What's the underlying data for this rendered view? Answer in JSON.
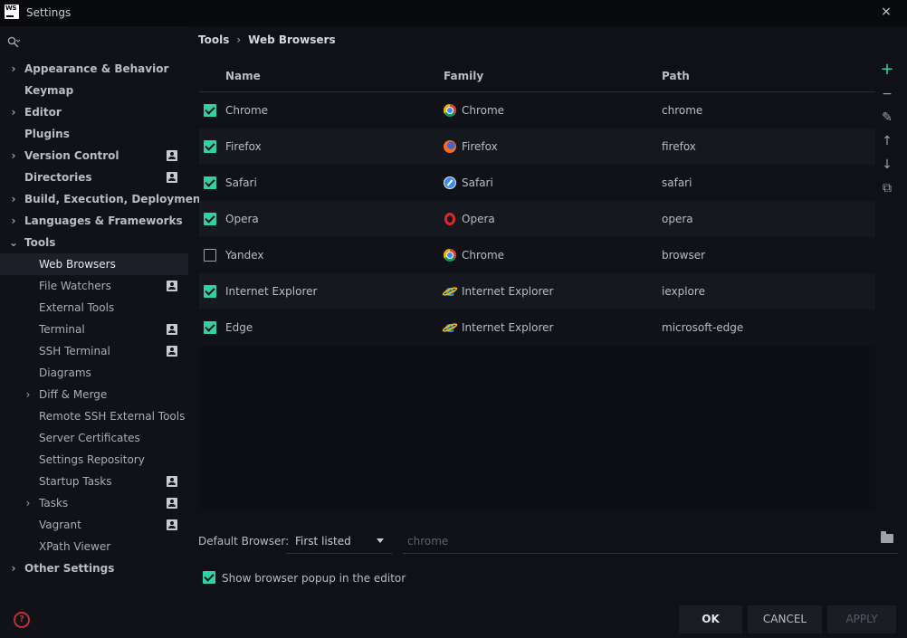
{
  "window": {
    "title": "Settings",
    "logo_text": "WS",
    "close_icon": "×"
  },
  "sidebar": {
    "search_placeholder": "",
    "items": [
      {
        "label": "Appearance & Behavior",
        "bold": true,
        "chevron": "›",
        "level": 0,
        "project": false
      },
      {
        "label": "Keymap",
        "bold": true,
        "chevron": "",
        "level": 0,
        "project": false
      },
      {
        "label": "Editor",
        "bold": true,
        "chevron": "›",
        "level": 0,
        "project": false
      },
      {
        "label": "Plugins",
        "bold": true,
        "chevron": "",
        "level": 0,
        "project": false
      },
      {
        "label": "Version Control",
        "bold": true,
        "chevron": "›",
        "level": 0,
        "project": true
      },
      {
        "label": "Directories",
        "bold": true,
        "chevron": "",
        "level": 0,
        "project": true
      },
      {
        "label": "Build, Execution, Deployment",
        "bold": true,
        "chevron": "›",
        "level": 0,
        "project": false
      },
      {
        "label": "Languages & Frameworks",
        "bold": true,
        "chevron": "›",
        "level": 0,
        "project": false
      },
      {
        "label": "Tools",
        "bold": true,
        "chevron": "⌄",
        "level": 0,
        "project": false
      },
      {
        "label": "Web Browsers",
        "bold": false,
        "chevron": "",
        "level": 1,
        "project": false,
        "selected": true
      },
      {
        "label": "File Watchers",
        "bold": false,
        "chevron": "",
        "level": 1,
        "project": true
      },
      {
        "label": "External Tools",
        "bold": false,
        "chevron": "",
        "level": 1,
        "project": false
      },
      {
        "label": "Terminal",
        "bold": false,
        "chevron": "",
        "level": 1,
        "project": true
      },
      {
        "label": "SSH Terminal",
        "bold": false,
        "chevron": "",
        "level": 1,
        "project": true
      },
      {
        "label": "Diagrams",
        "bold": false,
        "chevron": "",
        "level": 1,
        "project": false
      },
      {
        "label": "Diff & Merge",
        "bold": false,
        "chevron": "›",
        "level": 1,
        "project": false
      },
      {
        "label": "Remote SSH External Tools",
        "bold": false,
        "chevron": "",
        "level": 1,
        "project": false
      },
      {
        "label": "Server Certificates",
        "bold": false,
        "chevron": "",
        "level": 1,
        "project": false
      },
      {
        "label": "Settings Repository",
        "bold": false,
        "chevron": "",
        "level": 1,
        "project": false
      },
      {
        "label": "Startup Tasks",
        "bold": false,
        "chevron": "",
        "level": 1,
        "project": true
      },
      {
        "label": "Tasks",
        "bold": false,
        "chevron": "›",
        "level": 1,
        "project": true
      },
      {
        "label": "Vagrant",
        "bold": false,
        "chevron": "",
        "level": 1,
        "project": true
      },
      {
        "label": "XPath Viewer",
        "bold": false,
        "chevron": "",
        "level": 1,
        "project": false
      },
      {
        "label": "Other Settings",
        "bold": true,
        "chevron": "›",
        "level": 0,
        "project": false
      }
    ]
  },
  "breadcrumb": {
    "parent": "Tools",
    "separator": "›",
    "current": "Web Browsers"
  },
  "table": {
    "columns": {
      "name": "Name",
      "family": "Family",
      "path": "Path"
    },
    "rows": [
      {
        "checked": true,
        "name": "Chrome",
        "family": "Chrome",
        "family_icon": "chrome",
        "path": "chrome"
      },
      {
        "checked": true,
        "name": "Firefox",
        "family": "Firefox",
        "family_icon": "firefox",
        "path": "firefox"
      },
      {
        "checked": true,
        "name": "Safari",
        "family": "Safari",
        "family_icon": "safari",
        "path": "safari"
      },
      {
        "checked": true,
        "name": "Opera",
        "family": "Opera",
        "family_icon": "opera",
        "path": "opera"
      },
      {
        "checked": false,
        "name": "Yandex",
        "family": "Chrome",
        "family_icon": "chrome",
        "path": "browser"
      },
      {
        "checked": true,
        "name": "Internet Explorer",
        "family": "Internet Explorer",
        "family_icon": "ie",
        "path": "iexplore"
      },
      {
        "checked": true,
        "name": "Edge",
        "family": "Internet Explorer",
        "family_icon": "ie",
        "path": "microsoft-edge"
      }
    ]
  },
  "toolbar": {
    "add_icon": "+",
    "remove_icon": "−",
    "edit_icon": "✎",
    "up_icon": "↑",
    "down_icon": "↓",
    "copy_icon": "⧉"
  },
  "default_browser": {
    "label": "Default Browser:",
    "selected": "First listed",
    "path_placeholder": "chrome"
  },
  "popup_option": {
    "checked": true,
    "label": "Show browser popup in the editor"
  },
  "buttons": {
    "ok": "OK",
    "cancel": "CANCEL",
    "apply": "APPLY"
  },
  "colors": {
    "accent": "#2fd3a3",
    "background": "#0f1116",
    "help": "#c0303a"
  }
}
